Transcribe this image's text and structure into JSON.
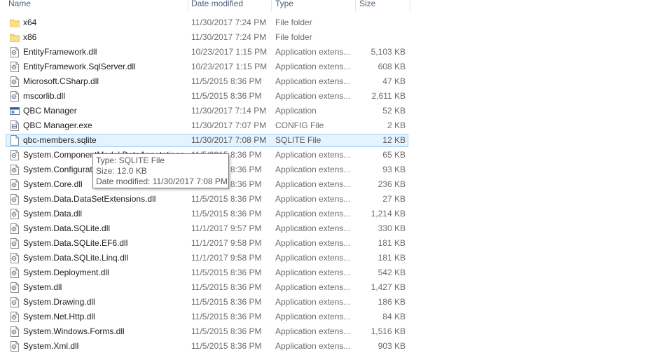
{
  "header": {
    "name": "Name",
    "date_modified": "Date modified",
    "type": "Type",
    "size": "Size"
  },
  "files": [
    {
      "name": "x64",
      "date": "11/30/2017 7:24 PM",
      "type": "File folder",
      "size": "",
      "icon": "folder-icon"
    },
    {
      "name": "x86",
      "date": "11/30/2017 7:24 PM",
      "type": "File folder",
      "size": "",
      "icon": "folder-icon"
    },
    {
      "name": "EntityFramework.dll",
      "date": "10/23/2017 1:15 PM",
      "type": "Application extens...",
      "size": "5,103 KB",
      "icon": "dll-icon"
    },
    {
      "name": "EntityFramework.SqlServer.dll",
      "date": "10/23/2017 1:15 PM",
      "type": "Application extens...",
      "size": "608 KB",
      "icon": "dll-icon"
    },
    {
      "name": "Microsoft.CSharp.dll",
      "date": "11/5/2015 8:36 PM",
      "type": "Application extens...",
      "size": "47 KB",
      "icon": "dll-icon"
    },
    {
      "name": "mscorlib.dll",
      "date": "11/5/2015 8:36 PM",
      "type": "Application extens...",
      "size": "2,611 KB",
      "icon": "dll-icon"
    },
    {
      "name": "QBC Manager",
      "date": "11/30/2017 7:14 PM",
      "type": "Application",
      "size": "52 KB",
      "icon": "application-icon"
    },
    {
      "name": "QBC Manager.exe",
      "date": "11/30/2017 7:07 PM",
      "type": "CONFIG File",
      "size": "2 KB",
      "icon": "config-file-icon"
    },
    {
      "name": "qbc-members.sqlite",
      "date": "11/30/2017 7:08 PM",
      "type": "SQLITE File",
      "size": "12 KB",
      "icon": "blank-file-icon",
      "selected": true
    },
    {
      "name": "System.ComponentModel.DataAnnotations.dll",
      "date": "11/5/2015 8:36 PM",
      "type": "Application extens...",
      "size": "65 KB",
      "icon": "dll-icon"
    },
    {
      "name": "System.Configuration.dll",
      "date": "11/5/2015 8:36 PM",
      "type": "Application extens...",
      "size": "93 KB",
      "icon": "dll-icon"
    },
    {
      "name": "System.Core.dll",
      "date": "11/5/2015 8:36 PM",
      "type": "Application extens...",
      "size": "236 KB",
      "icon": "dll-icon"
    },
    {
      "name": "System.Data.DataSetExtensions.dll",
      "date": "11/5/2015 8:36 PM",
      "type": "Application extens...",
      "size": "27 KB",
      "icon": "dll-icon"
    },
    {
      "name": "System.Data.dll",
      "date": "11/5/2015 8:36 PM",
      "type": "Application extens...",
      "size": "1,214 KB",
      "icon": "dll-icon"
    },
    {
      "name": "System.Data.SQLite.dll",
      "date": "11/1/2017 9:57 PM",
      "type": "Application extens...",
      "size": "330 KB",
      "icon": "dll-icon"
    },
    {
      "name": "System.Data.SQLite.EF6.dll",
      "date": "11/1/2017 9:58 PM",
      "type": "Application extens...",
      "size": "181 KB",
      "icon": "dll-icon"
    },
    {
      "name": "System.Data.SQLite.Linq.dll",
      "date": "11/1/2017 9:58 PM",
      "type": "Application extens...",
      "size": "181 KB",
      "icon": "dll-icon"
    },
    {
      "name": "System.Deployment.dll",
      "date": "11/5/2015 8:36 PM",
      "type": "Application extens...",
      "size": "542 KB",
      "icon": "dll-icon"
    },
    {
      "name": "System.dll",
      "date": "11/5/2015 8:36 PM",
      "type": "Application extens...",
      "size": "1,427 KB",
      "icon": "dll-icon"
    },
    {
      "name": "System.Drawing.dll",
      "date": "11/5/2015 8:36 PM",
      "type": "Application extens...",
      "size": "186 KB",
      "icon": "dll-icon"
    },
    {
      "name": "System.Net.Http.dll",
      "date": "11/5/2015 8:36 PM",
      "type": "Application extens...",
      "size": "84 KB",
      "icon": "dll-icon"
    },
    {
      "name": "System.Windows.Forms.dll",
      "date": "11/5/2015 8:36 PM",
      "type": "Application extens...",
      "size": "1,516 KB",
      "icon": "dll-icon"
    },
    {
      "name": "System.Xml.dll",
      "date": "11/5/2015 8:36 PM",
      "type": "Application extens...",
      "size": "903 KB",
      "icon": "dll-icon"
    }
  ],
  "tooltip": {
    "type_line": "Type: SQLITE File",
    "size_line": "Size: 12.0 KB",
    "date_line": "Date modified: 11/30/2017 7:08 PM"
  },
  "colors": {
    "selection_bg": "#e5f3ff",
    "selection_border": "#99d1ff",
    "folder": "#f8d775",
    "header_text": "#4c607a"
  }
}
